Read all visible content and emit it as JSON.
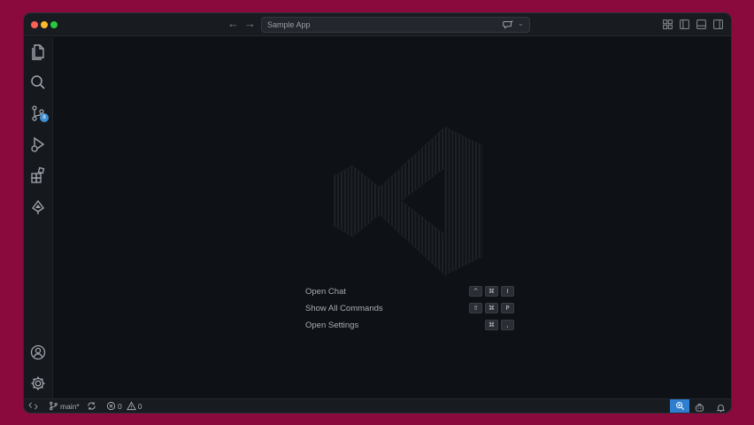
{
  "window": {
    "command_center": {
      "label": "Sample App",
      "chat_icon": "chat-sparkle-icon",
      "dropdown_icon": "chevron-down-icon"
    },
    "nav": {
      "back_icon": "arrow-left-icon",
      "forward_icon": "arrow-right-icon"
    },
    "layout_icons": [
      "customize-layout-icon",
      "toggle-primary-sidebar-icon",
      "toggle-panel-icon",
      "toggle-secondary-sidebar-icon"
    ]
  },
  "activity_bar": {
    "items": [
      {
        "name": "explorer",
        "icon": "files-icon"
      },
      {
        "name": "search",
        "icon": "search-icon"
      },
      {
        "name": "source-control",
        "icon": "source-control-icon",
        "badge": "8"
      },
      {
        "name": "run-and-debug",
        "icon": "run-debug-icon"
      },
      {
        "name": "extensions",
        "icon": "extensions-icon"
      },
      {
        "name": "remote-explorer",
        "icon": "remote-explorer-icon"
      }
    ],
    "bottom": [
      {
        "name": "accounts",
        "icon": "account-icon"
      },
      {
        "name": "manage",
        "icon": "gear-icon"
      }
    ]
  },
  "shortcuts": [
    {
      "label": "Open Chat",
      "keys": [
        "^",
        "⌘",
        "I"
      ]
    },
    {
      "label": "Show All Commands",
      "keys": [
        "⇧",
        "⌘",
        "P"
      ]
    },
    {
      "label": "Open Settings",
      "keys": [
        "⌘",
        ","
      ]
    }
  ],
  "statusbar": {
    "branch": "main*",
    "errors": "0",
    "warnings": "0"
  },
  "colors": {
    "background": "#8a0a3e",
    "editor": "#0e1115",
    "accent": "#2f7fd0",
    "badge": "#3d8fd1"
  }
}
